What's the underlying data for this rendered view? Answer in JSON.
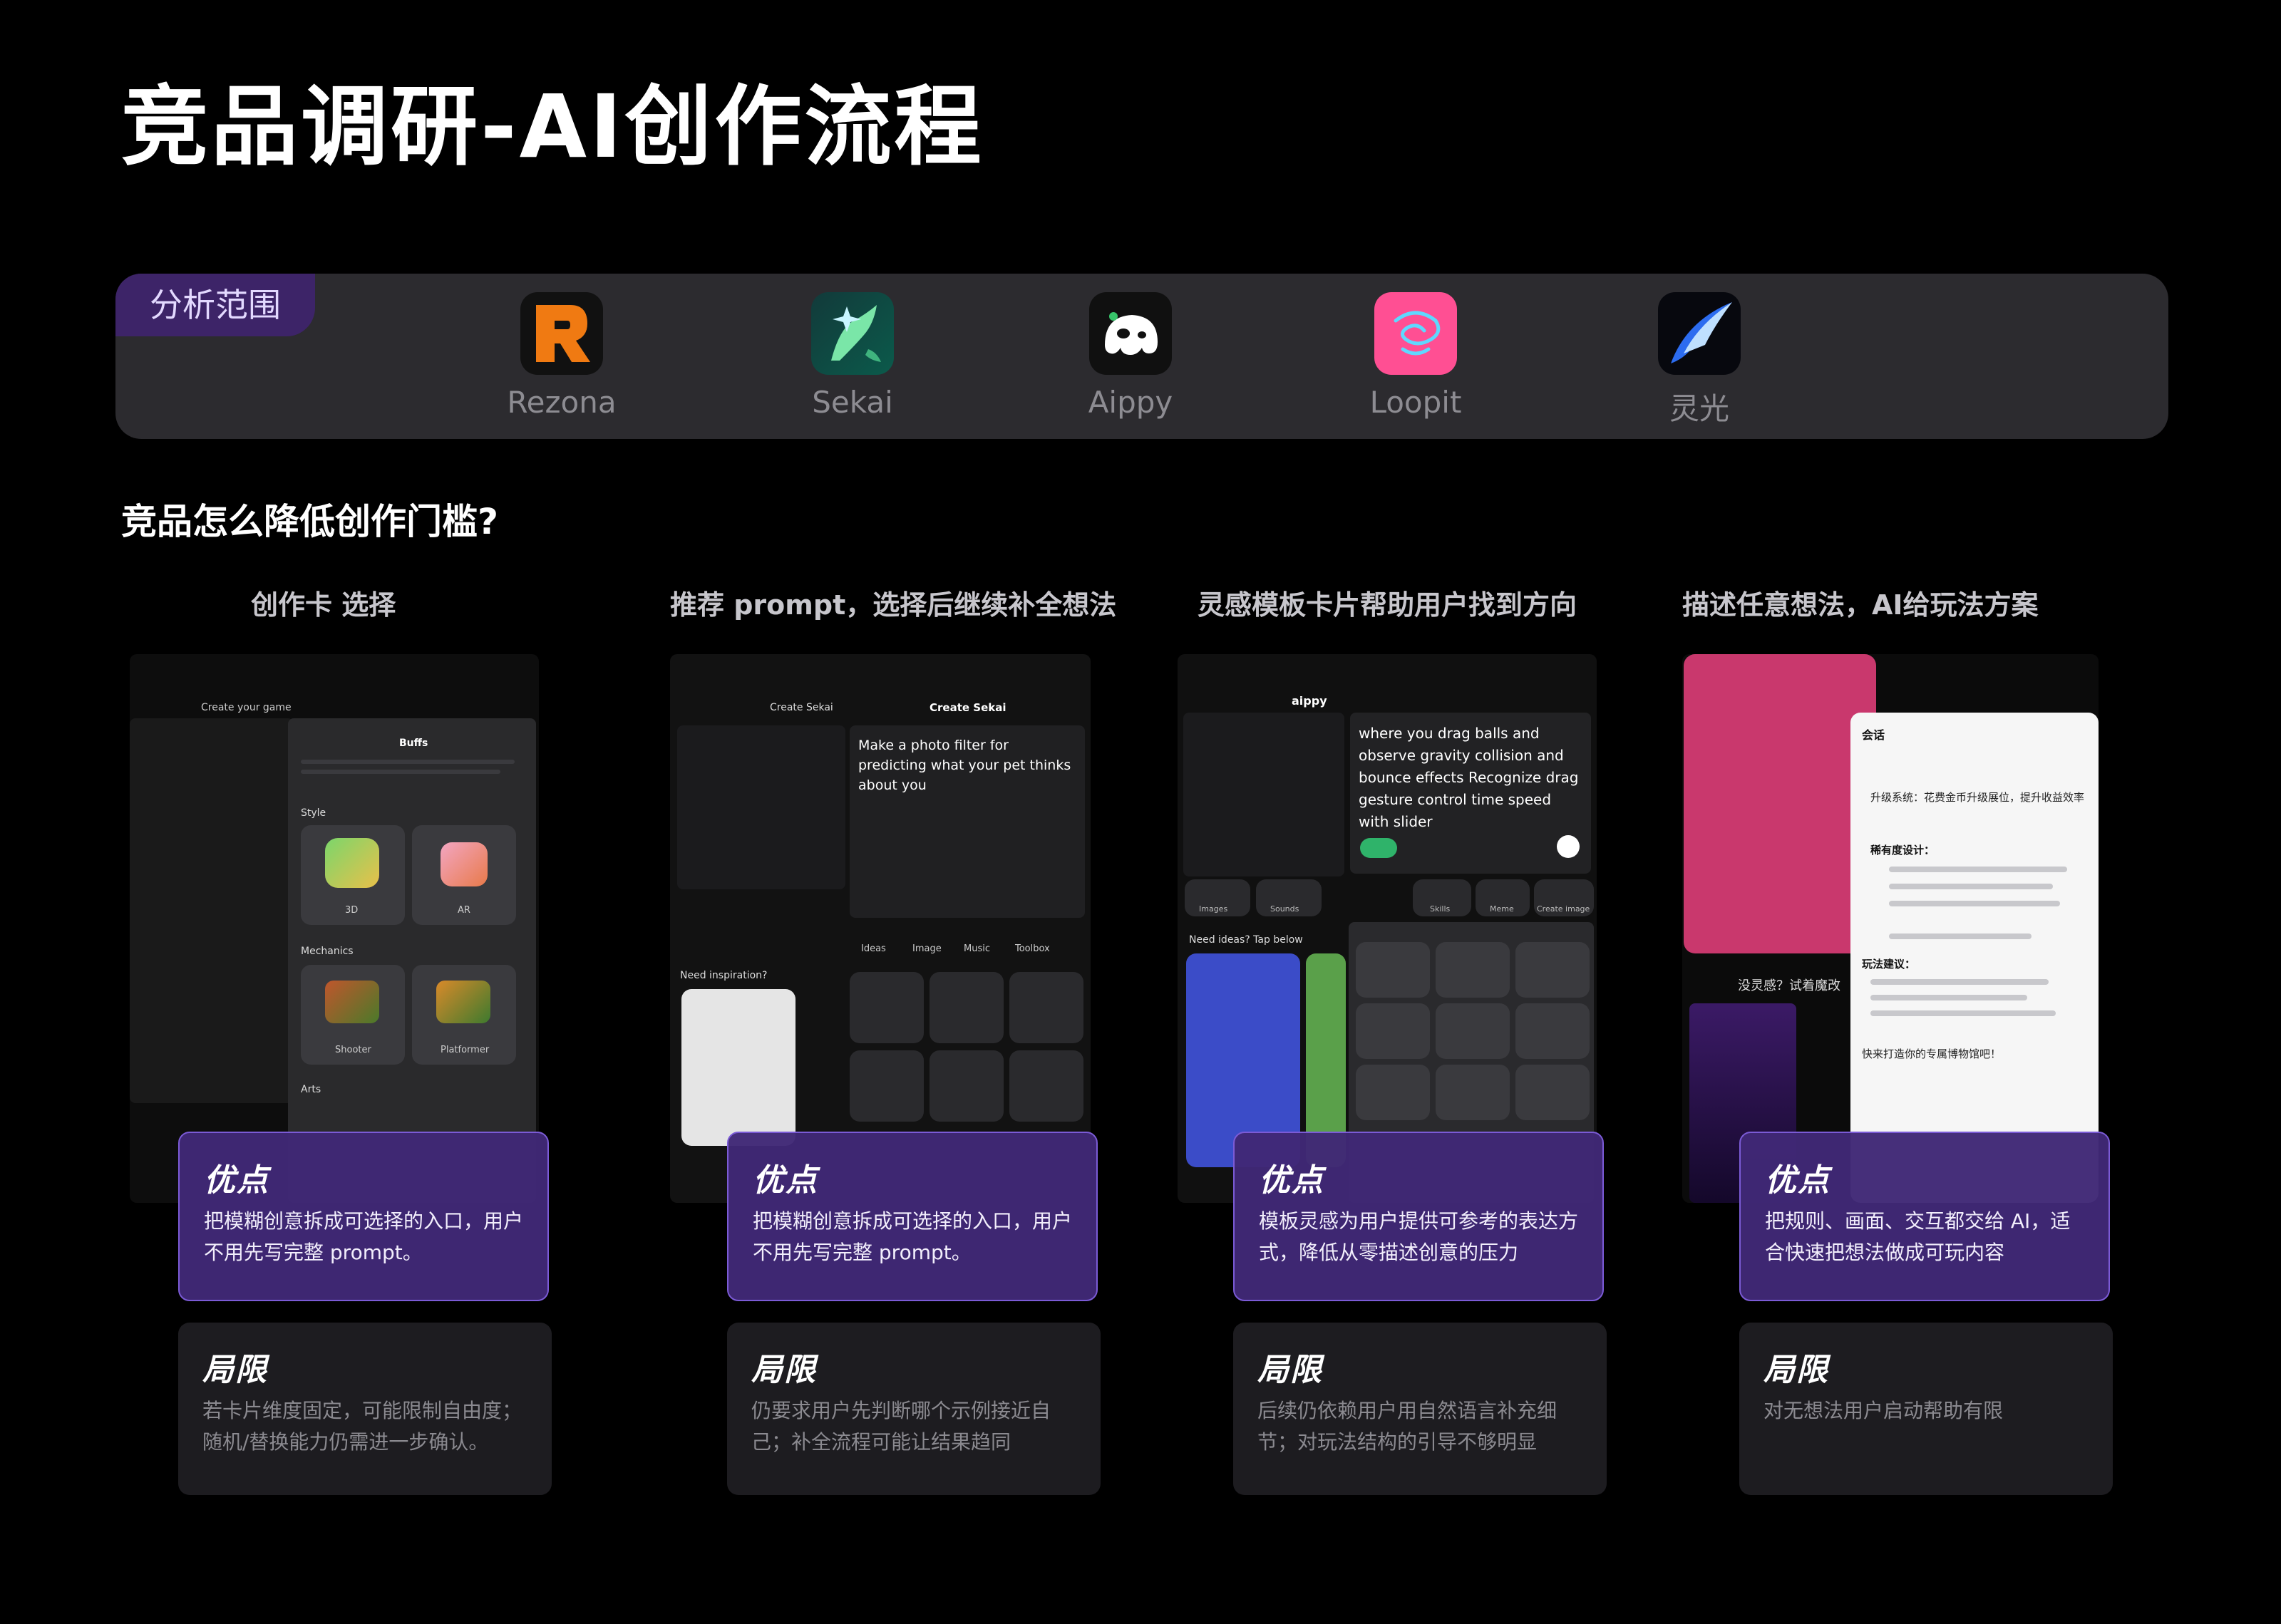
{
  "page": {
    "title": "竞品调研-AI创作流程"
  },
  "scope": {
    "tag": "分析范围",
    "apps": [
      {
        "name": "Rezona",
        "icon": "rezona-logo-icon",
        "color": "#f07a12"
      },
      {
        "name": "Sekai",
        "icon": "sekai-logo-icon",
        "color": "#1f8c73"
      },
      {
        "name": "Aippy",
        "icon": "aippy-logo-icon",
        "color": "#111111"
      },
      {
        "name": "Loopit",
        "icon": "loopit-logo-icon",
        "color": "#ff4f93"
      },
      {
        "name": "灵光",
        "icon": "lingguang-logo-icon",
        "color": "#1b3c8f"
      }
    ]
  },
  "question": "竞品怎么降低创作门槛?",
  "columns": [
    {
      "heading": "创作卡 选择",
      "screenshot": {
        "texts": [
          "Create your game",
          "Buffs",
          "Style",
          "3D",
          "AR",
          "Mechanics",
          "Shooter",
          "Platformer",
          "Arts"
        ]
      },
      "advantage": {
        "label": "优点",
        "text": "把模糊创意拆成可选择的入口，用户不用先写完整 prompt。"
      },
      "limitation": {
        "label": "局限",
        "text": "若卡片维度固定，可能限制自由度；随机/替换能力仍需进一步确认。"
      }
    },
    {
      "heading": "推荐 prompt，选择后继续补全想法",
      "screenshot": {
        "texts": [
          "Create Sekai",
          "Create Sekai",
          "Make a photo filter for predicting what your pet thinks about you",
          "Need inspiration?",
          "Ideas",
          "Image",
          "Music",
          "Toolbox"
        ]
      },
      "advantage": {
        "label": "优点",
        "text": "把模糊创意拆成可选择的入口，用户不用先写完整 prompt。"
      },
      "limitation": {
        "label": "局限",
        "text": "仍要求用户先判断哪个示例接近自己；补全流程可能让结果趋同"
      }
    },
    {
      "heading": "灵感模板卡片帮助用户找到方向",
      "screenshot": {
        "texts": [
          "aippy",
          "where you drag balls and observe gravity collision and bounce effects Recognize drag gesture control time speed with slider",
          "Need ideas? Tap below",
          "Images",
          "Sounds",
          "Skills",
          "Meme",
          "Create image"
        ]
      },
      "advantage": {
        "label": "优点",
        "text": "模板灵感为用户提供可参考的表达方式，降低从零描述创意的压力"
      },
      "limitation": {
        "label": "局限",
        "text": "后续仍依赖用户用自然语言补充细节；对玩法结构的引导不够明显"
      }
    },
    {
      "heading": "描述任意想法，AI给玩法方案",
      "screenshot": {
        "texts": [
          "会话",
          "升级系统：花费金币升级展位，提升收益效率",
          "稀有度设计：",
          "玩法建议：",
          "快来打造你的专属博物馆吧！",
          "没灵感？试着魔改"
        ]
      },
      "advantage": {
        "label": "优点",
        "text": "把规则、画面、交互都交给 AI，适合快速把想法做成可玩内容"
      },
      "limitation": {
        "label": "局限",
        "text": "对无想法用户启动帮助有限"
      }
    }
  ]
}
